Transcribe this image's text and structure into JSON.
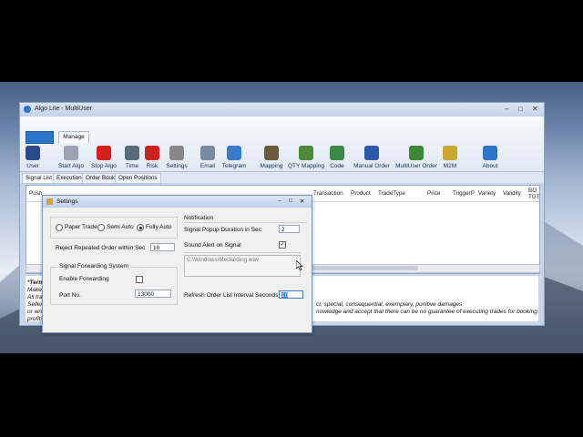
{
  "window": {
    "title": "Algo Lite - MultiUser",
    "controls": [
      "–",
      "□",
      "✕"
    ]
  },
  "ribbon": {
    "manage_tab": "Manage",
    "buttons": [
      {
        "label": "User",
        "icon": "user-icon",
        "color": "#2b4a8a"
      },
      {
        "label": "Start Algo",
        "icon": "play-icon",
        "color": "#9aa4b0"
      },
      {
        "label": "Stop Algo",
        "icon": "stop-icon",
        "color": "#d62020"
      },
      {
        "label": "Time",
        "icon": "clock-icon",
        "color": "#5a6a7a"
      },
      {
        "label": "Risk",
        "icon": "warning-icon",
        "color": "#cc2222"
      },
      {
        "label": "Settings",
        "icon": "tools-icon",
        "color": "#888"
      },
      {
        "label": "Email",
        "icon": "mail-icon",
        "color": "#7a8aa4"
      },
      {
        "label": "Telegram",
        "icon": "at-icon",
        "color": "#3a7bc8"
      },
      {
        "label": "Mapping",
        "icon": "mapping-icon",
        "color": "#6a5a3a"
      },
      {
        "label": "QTY Mapping",
        "icon": "qty-icon",
        "color": "#4a8a3a"
      },
      {
        "label": "Code",
        "icon": "code-icon",
        "color": "#3a8a4a"
      },
      {
        "label": "Manual Order",
        "icon": "list-icon",
        "color": "#2b5aa8"
      },
      {
        "label": "MultiUser Order",
        "icon": "order-icon",
        "color": "#3a8a3a"
      },
      {
        "label": "M2M",
        "icon": "users-icon",
        "color": "#c8a830"
      },
      {
        "label": "About",
        "icon": "info-icon",
        "color": "#2b74c8"
      }
    ]
  },
  "tabs": [
    "Signal List",
    "Execution",
    "Order Book",
    "Open Positions"
  ],
  "grid": {
    "columns": [
      "Push",
      "Transaction",
      "Product",
      "TradeType",
      "Price",
      "TriggerP",
      "Variety",
      "Validity",
      "BO\nTGT"
    ]
  },
  "disclaimer": {
    "line1": "*Terms",
    "line2": "Make",
    "line3": "All tra",
    "line4": "Seller",
    "line5": "or wro",
    "line6": "profits",
    "tail1": "ct, special, consequential, exemplary, punitive damages",
    "tail2": "nowledge and accept that there can be no guarantee of executing trades for booking"
  },
  "settings": {
    "title": "Settings",
    "mode": {
      "paper": "Paper Trade",
      "semi": "Semi Auto",
      "fully": "Fully Auto",
      "selected": "fully"
    },
    "reject_label": "Reject Repeated Order within Sec",
    "reject_value": "10",
    "fwd_group": "Signal Forwarding System",
    "enable_fwd_label": "Enable Forwarding",
    "enable_fwd": false,
    "port_label": "Port No.",
    "port_value": "13000",
    "notif_group": "Notification",
    "popup_label": "Signal Popup Duration in Sec",
    "popup_value": "2",
    "sound_label": "Sound Alert on Signal",
    "sound_checked": true,
    "sound_path": "C:\\Windows\\Media\\ding.wav",
    "refresh_label": "Refresh Order List Interval Seconds",
    "refresh_value": "10"
  }
}
